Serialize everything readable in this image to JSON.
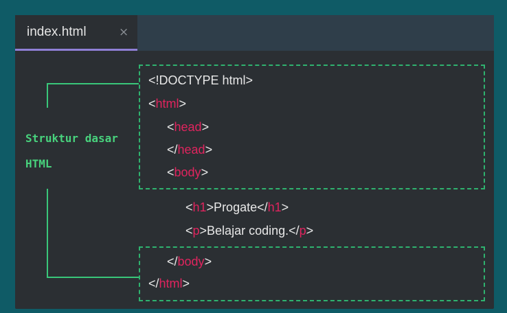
{
  "tab": {
    "label": "index.html",
    "close_glyph": "×"
  },
  "annotation": {
    "line1": "Struktur dasar",
    "line2": "HTML"
  },
  "code": [
    {
      "parts": [
        {
          "t": "<!DOCTYPE html>",
          "c": "text"
        }
      ]
    },
    {
      "parts": [
        {
          "t": "<",
          "c": "text"
        },
        {
          "t": "html",
          "c": "tag"
        },
        {
          "t": ">",
          "c": "text"
        }
      ]
    },
    {
      "parts": [
        {
          "t": "<",
          "c": "text"
        },
        {
          "t": "head",
          "c": "tag"
        },
        {
          "t": ">",
          "c": "text"
        }
      ]
    },
    {
      "parts": [
        {
          "t": "</",
          "c": "text"
        },
        {
          "t": "head",
          "c": "tag"
        },
        {
          "t": ">",
          "c": "text"
        }
      ]
    },
    {
      "parts": [
        {
          "t": "<",
          "c": "text"
        },
        {
          "t": "body",
          "c": "tag"
        },
        {
          "t": ">",
          "c": "text"
        }
      ]
    },
    {
      "parts": [
        {
          "t": "<",
          "c": "text"
        },
        {
          "t": "h1",
          "c": "tag"
        },
        {
          "t": ">Progate</",
          "c": "text"
        },
        {
          "t": "h1",
          "c": "tag"
        },
        {
          "t": ">",
          "c": "text"
        }
      ]
    },
    {
      "parts": [
        {
          "t": "<",
          "c": "text"
        },
        {
          "t": "p",
          "c": "tag"
        },
        {
          "t": ">Belajar coding.</",
          "c": "text"
        },
        {
          "t": "p",
          "c": "tag"
        },
        {
          "t": ">",
          "c": "text"
        }
      ]
    },
    {
      "parts": [
        {
          "t": "</",
          "c": "text"
        },
        {
          "t": "body",
          "c": "tag"
        },
        {
          "t": ">",
          "c": "text"
        }
      ]
    },
    {
      "parts": [
        {
          "t": "</",
          "c": "text"
        },
        {
          "t": "html",
          "c": "tag"
        },
        {
          "t": ">",
          "c": "text"
        }
      ]
    }
  ],
  "colors": {
    "background": "#0f5b66",
    "editor": "#2b2f33",
    "tag": "#e0245e",
    "text": "#e8e8e8",
    "annotation": "#48d27d",
    "tab_underline": "#8f7fd6"
  }
}
